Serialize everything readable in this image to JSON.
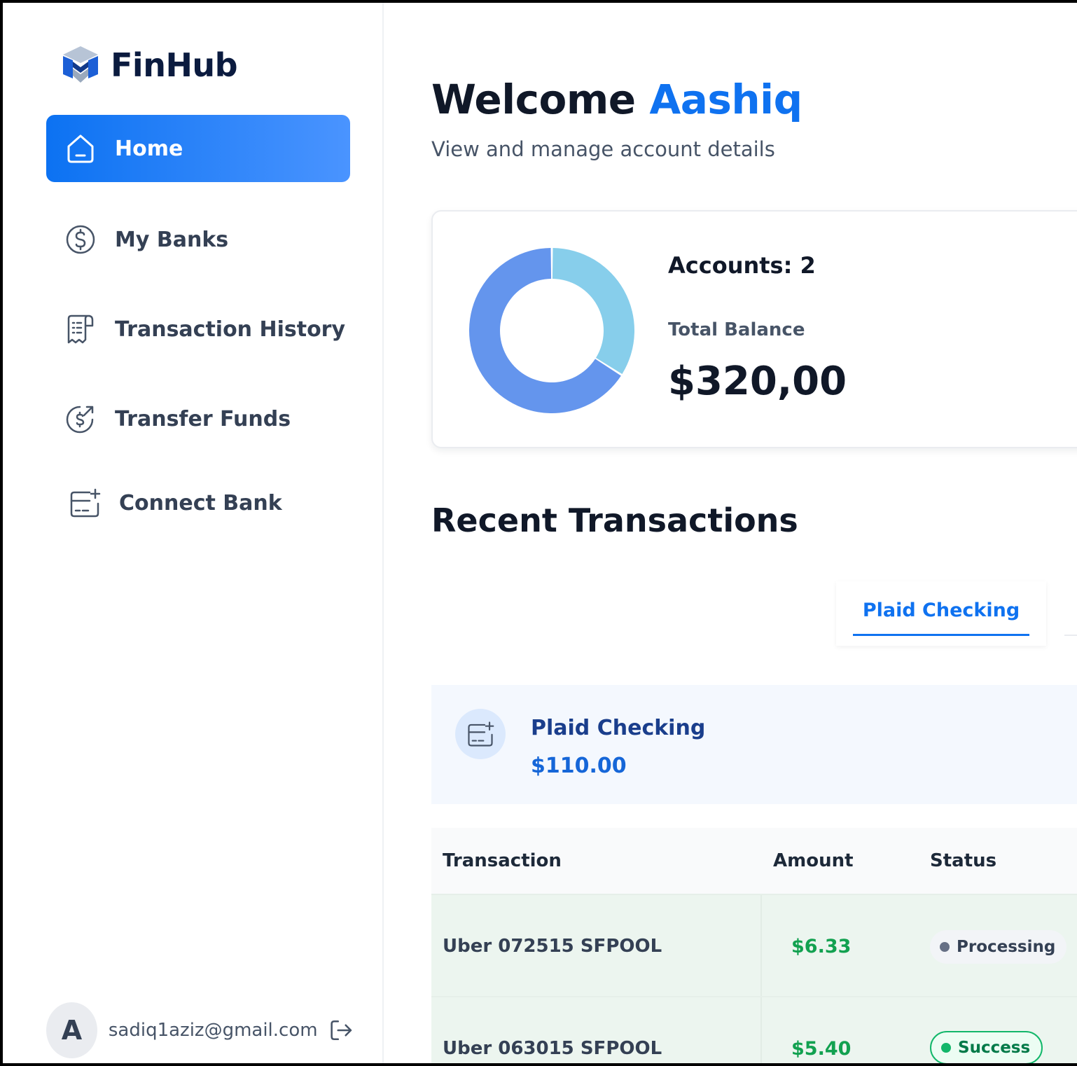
{
  "app": {
    "name": "FinHub"
  },
  "sidebar": {
    "items": [
      {
        "label": "Home",
        "icon": "home-icon",
        "active": true
      },
      {
        "label": "My Banks",
        "icon": "dollar-circle-icon",
        "active": false
      },
      {
        "label": "Transaction History",
        "icon": "receipt-icon",
        "active": false
      },
      {
        "label": "Transfer Funds",
        "icon": "money-send-icon",
        "active": false
      },
      {
        "label": "Connect Bank",
        "icon": "card-add-icon",
        "active": false
      }
    ],
    "user": {
      "initial": "A",
      "email": "sadiq1aziz@gmail.com",
      "logout_icon": "logout-icon"
    }
  },
  "header": {
    "greeting": "Welcome",
    "user_name": "Aashiq",
    "subtitle": "View and manage account details"
  },
  "balance_card": {
    "accounts_text": "Accounts: 2",
    "total_label": "Total Balance",
    "total_value": "$320,00"
  },
  "chart_data": {
    "type": "pie",
    "donut": true,
    "values": [
      34,
      66
    ],
    "colors": [
      "#87ceeb",
      "#6495ed"
    ]
  },
  "recent": {
    "title": "Recent Transactions",
    "tabs": [
      {
        "label": "Plaid Checking",
        "active": true
      }
    ],
    "bank": {
      "name": "Plaid Checking",
      "balance": "$110.00",
      "icon": "card-add-icon"
    },
    "table": {
      "headers": [
        "Transaction",
        "Amount",
        "Status"
      ],
      "rows": [
        {
          "name": "Uber 072515 SFPOOL",
          "amount": "$6.33",
          "status": "Processing"
        },
        {
          "name": "Uber 063015 SFPOOL",
          "amount": "$5.40",
          "status": "Success"
        }
      ]
    }
  },
  "colors": {
    "accent": "#0f72f0",
    "success": "#12a150",
    "brand_dark": "#0b1b3f"
  }
}
